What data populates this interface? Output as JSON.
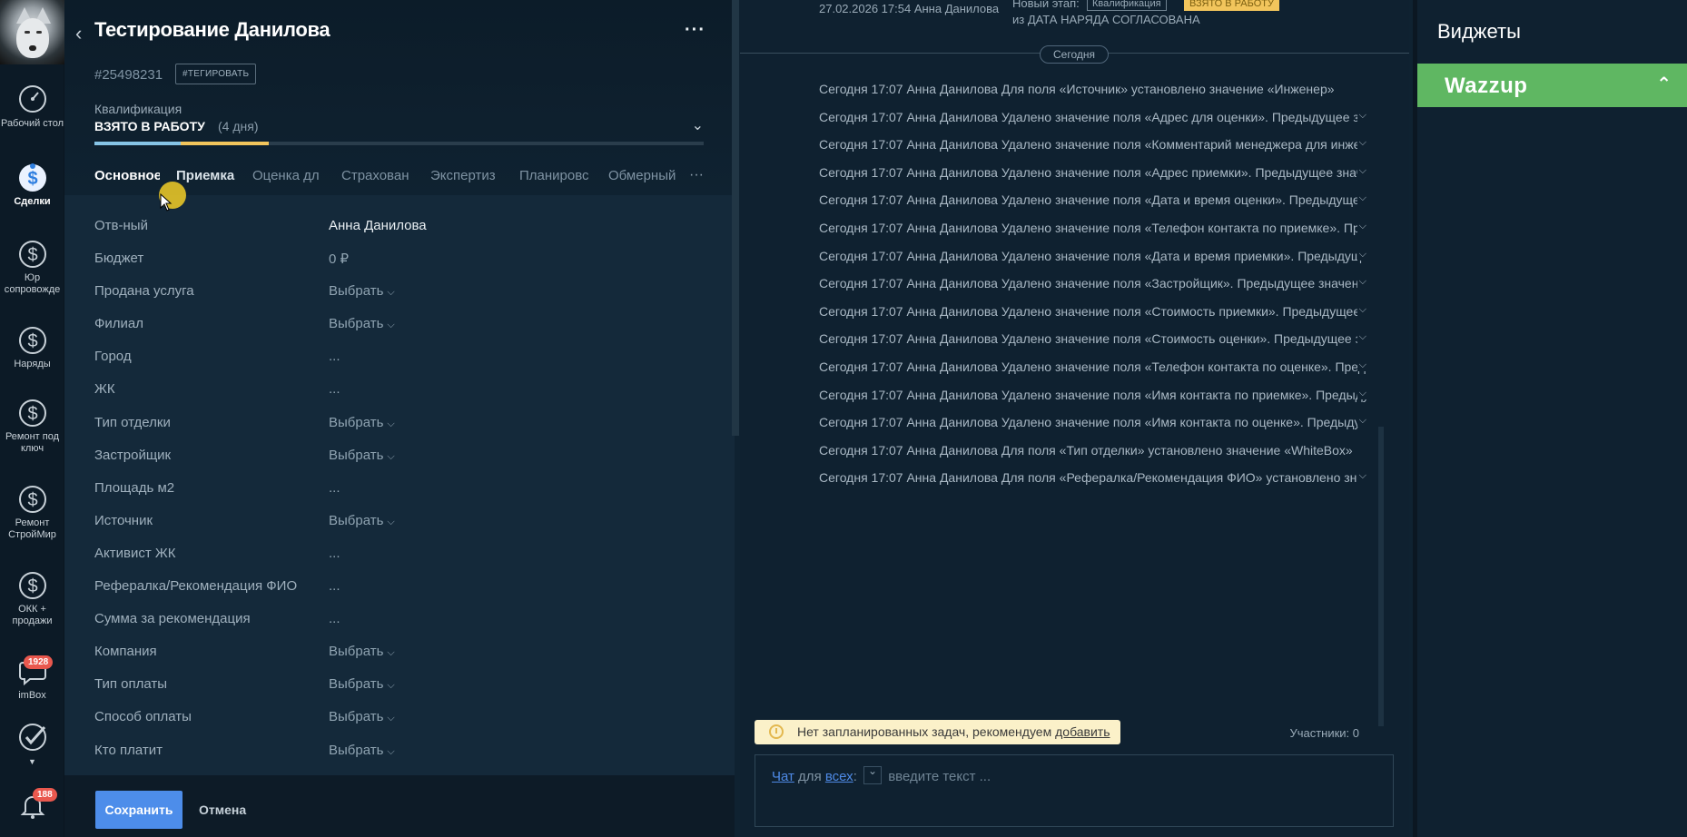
{
  "nav": {
    "items": [
      {
        "label": "Рабочий стол",
        "icon": "dashboard-icon"
      },
      {
        "label": "Сделки",
        "icon": "deals-icon"
      },
      {
        "label": "Юр сопровожде",
        "icon": "dollar-icon"
      },
      {
        "label": "Наряды",
        "icon": "dollar-icon"
      },
      {
        "label": "Ремонт под ключ",
        "icon": "dollar-icon"
      },
      {
        "label": "Ремонт СтройМир",
        "icon": "dollar-icon"
      },
      {
        "label": "ОКК + продажи",
        "icon": "dollar-icon"
      },
      {
        "label": "imBox",
        "icon": "chat-icon",
        "badge": "1928"
      },
      {
        "label": "",
        "icon": "check-icon"
      },
      {
        "label": "",
        "icon": "bell-icon",
        "badge": "188"
      }
    ]
  },
  "lead": {
    "title": "Тестирование Данилова",
    "id": "#25498231",
    "tag_button": "#ТЕГИРОВАТЬ",
    "stage_label": "Квалификация",
    "stage_name": "ВЗЯТО В РАБОТУ",
    "stage_days": "(4 дня)",
    "tabs": [
      "Основное",
      "Приемка",
      "Оценка дл",
      "Страхован",
      "Экспертиз",
      "Планировс",
      "Обмерный"
    ],
    "fields": [
      {
        "label": "Отв-ный",
        "value": "Анна Данилова",
        "type": "text"
      },
      {
        "label": "Бюджет",
        "value": "0 ₽",
        "type": "text"
      },
      {
        "label": "Продана услуга",
        "value": "Выбрать",
        "type": "select"
      },
      {
        "label": "Филиал",
        "value": "Выбрать",
        "type": "select"
      },
      {
        "label": "Город",
        "value": "...",
        "type": "empty"
      },
      {
        "label": "ЖК",
        "value": "...",
        "type": "empty"
      },
      {
        "label": "Тип отделки",
        "value": "Выбрать",
        "type": "select"
      },
      {
        "label": "Застройщик",
        "value": "Выбрать",
        "type": "select"
      },
      {
        "label": "Площадь м2",
        "value": "...",
        "type": "empty"
      },
      {
        "label": "Источник",
        "value": "Выбрать",
        "type": "select"
      },
      {
        "label": "Активист ЖК",
        "value": "...",
        "type": "empty"
      },
      {
        "label": "Рефералка/Рекомендация ФИО",
        "value": "...",
        "type": "empty"
      },
      {
        "label": "Сумма за рекомендация",
        "value": "...",
        "type": "empty"
      },
      {
        "label": "Компания",
        "value": "Выбрать",
        "type": "select"
      },
      {
        "label": "Тип оплаты",
        "value": "Выбрать",
        "type": "select"
      },
      {
        "label": "Способ оплаты",
        "value": "Выбрать",
        "type": "select"
      },
      {
        "label": "Кто платит",
        "value": "Выбрать",
        "type": "select"
      }
    ],
    "save_label": "Сохранить",
    "cancel_label": "Отмена"
  },
  "feed": {
    "top_date": "27.02.2026 17:54 Анна Данилова",
    "top_new_stage": "Новый этап:",
    "top_pill_stage": "Квалификация",
    "top_pill_status": "ВЗЯТО В РАБОТУ",
    "top_from": "из ДАТА НАРЯДА СОГЛАСОВАНА",
    "today_label": "Сегодня",
    "items": [
      {
        "text": "Сегодня 17:07 Анна Данилова Для поля «Источник» установлено значение «Инженер»",
        "expand": false
      },
      {
        "text": "Сегодня 17:07 Анна Данилова Удалено значение поля «Адрес для оценки». Предыдущее значение",
        "expand": true
      },
      {
        "text": "Сегодня 17:07 Анна Данилова Удалено значение поля «Комментарий менеджера для инженера»",
        "expand": true
      },
      {
        "text": "Сегодня 17:07 Анна Данилова Удалено значение поля «Адрес приемки». Предыдущее значение",
        "expand": true
      },
      {
        "text": "Сегодня 17:07 Анна Данилова Удалено значение поля «Дата и время оценки». Предыдущее знач",
        "expand": true
      },
      {
        "text": "Сегодня 17:07 Анна Данилова Удалено значение поля «Телефон контакта по приемке». Преды",
        "expand": true
      },
      {
        "text": "Сегодня 17:07 Анна Данилова Удалено значение поля «Дата и время приемки». Предыдущее з",
        "expand": true
      },
      {
        "text": "Сегодня 17:07 Анна Данилова Удалено значение поля «Застройщик». Предыдущее значение «",
        "expand": true
      },
      {
        "text": "Сегодня 17:07 Анна Данилова Удалено значение поля «Стоимость приемки». Предыдущее зна",
        "expand": true
      },
      {
        "text": "Сегодня 17:07 Анна Данилова Удалено значение поля «Стоимость оценки». Предыдущее зна",
        "expand": true
      },
      {
        "text": "Сегодня 17:07 Анна Данилова Удалено значение поля «Телефон контакта по оценке». Предыд",
        "expand": true
      },
      {
        "text": "Сегодня 17:07 Анна Данилова Удалено значение поля «Имя контакта по приемке». Предыдущ",
        "expand": true
      },
      {
        "text": "Сегодня 17:07 Анна Данилова Удалено значение поля «Имя контакта по оценке». Предыдуще",
        "expand": true
      },
      {
        "text": "Сегодня 17:07 Анна Данилова Для поля «Тип отделки» установлено значение «WhiteBox»",
        "expand": false
      },
      {
        "text": "Сегодня 17:07 Анна Данилова Для поля «Рефералка/Рекомендация ФИО» установлено значен",
        "expand": true
      }
    ],
    "notice_text": "Нет запланированных задач, рекомендуем ",
    "notice_link": "добавить",
    "participants": "Участники: 0",
    "chat_link": "Чат",
    "chat_for": " для ",
    "chat_all": "всех",
    "chat_colon": ":",
    "chat_placeholder": "введите текст ..."
  },
  "widgets": {
    "title": "Виджеты",
    "wazzup": "Wazzup"
  }
}
